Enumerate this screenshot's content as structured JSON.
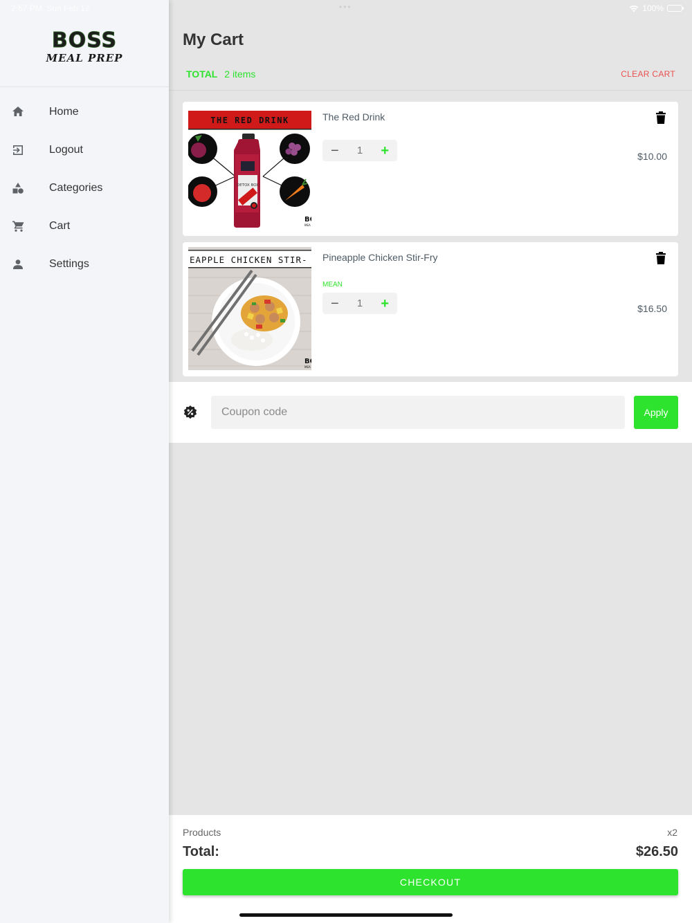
{
  "status_bar": {
    "time": "2:57 PM",
    "date": "Sun Feb 12",
    "battery": "100%",
    "battery_level": 1.0
  },
  "sidebar": {
    "logo": {
      "line1": "BOSS",
      "line2": "MEAL PREP"
    },
    "items": [
      {
        "label": "Home",
        "icon": "home-icon"
      },
      {
        "label": "Logout",
        "icon": "logout-icon"
      },
      {
        "label": "Categories",
        "icon": "categories-icon"
      },
      {
        "label": "Cart",
        "icon": "cart-icon"
      },
      {
        "label": "Settings",
        "icon": "person-icon"
      }
    ]
  },
  "cart": {
    "title": "My Cart",
    "total_label": "TOTAL",
    "total_count": "2 items",
    "clear_label": "CLEAR CART",
    "items": [
      {
        "name": "The Red Drink",
        "variant": "",
        "quantity": "1",
        "price": "$10.00",
        "image_caption": "THE RED DRINK",
        "image_label": "DETOX BOX"
      },
      {
        "name": "Pineapple Chicken Stir-Fry",
        "variant": "MEAN",
        "quantity": "1",
        "price": "$16.50",
        "image_caption": "EAPPLE CHICKEN STIR-"
      }
    ]
  },
  "coupon": {
    "placeholder": "Coupon code",
    "apply_label": "Apply"
  },
  "summary": {
    "products_label": "Products",
    "products_count": "x2",
    "total_label": "Total:",
    "total_value": "$26.50",
    "checkout_label": "CHECKOUT"
  },
  "colors": {
    "accent": "#2ee32e",
    "danger": "#eb4f4f",
    "sidebar_bg": "#f4f5f8",
    "main_bg": "#e5e5e5"
  }
}
